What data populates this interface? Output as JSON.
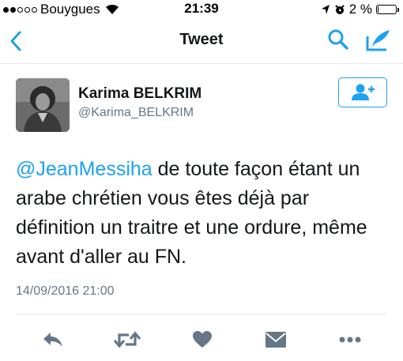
{
  "status_bar": {
    "carrier": "Bouygues",
    "time": "21:39",
    "battery": "2 %",
    "battery_level": 0.02,
    "signal_bars": 2
  },
  "nav": {
    "title": "Tweet",
    "icons": [
      "chevron-left-icon",
      "search-icon",
      "compose-icon"
    ]
  },
  "tweet": {
    "author_name": "Karima BELKRIM",
    "author_handle": "@Karima_BELKRIM",
    "mention": "@JeanMessiha",
    "text": " de toute façon étant un arabe chrétien vous êtes déjà par définition un traitre et une ordure, même avant d'aller au FN.",
    "timestamp": "14/09/2016 21:00"
  },
  "actions": [
    "reply-icon",
    "retweet-icon",
    "like-icon",
    "message-icon",
    "more-icon"
  ],
  "colors": {
    "accent": "#1da1f2",
    "icon_gray": "#657786",
    "text": "#14171a",
    "divider": "#e1e8ed"
  }
}
